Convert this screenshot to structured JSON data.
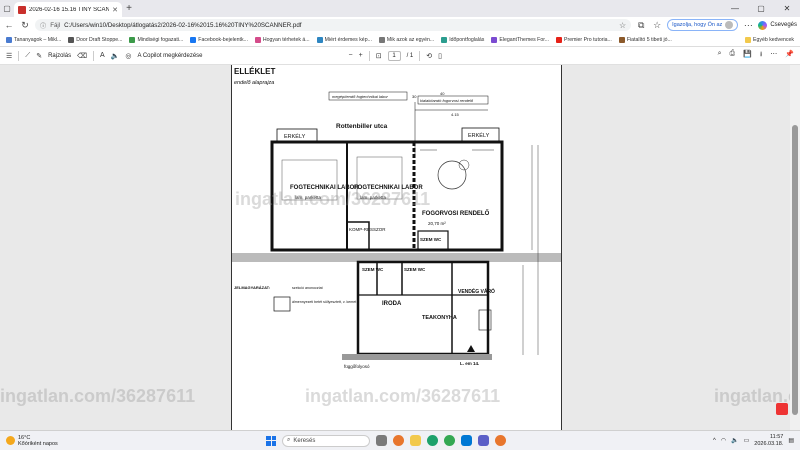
{
  "tab": {
    "title": "2026-02-16 15.16 TINY SCANNER"
  },
  "address": {
    "label": "Fájl",
    "url": "C:/Users/win10/Desktop/átlogatás2/2026-02-16%2015.16%20TINY%20SCANNER.pdf"
  },
  "signin": {
    "label": "Igazolja, hogy Ön az"
  },
  "copilot": {
    "label": "Csevegés"
  },
  "bookmarks": [
    {
      "label": "Tananyagok – Mikl...",
      "color": "#4a7bd0"
    },
    {
      "label": "Door Draft Stoppe...",
      "color": "#555555"
    },
    {
      "label": "Mindiségi fogazati...",
      "color": "#3c9a4a"
    },
    {
      "label": "Facebook-bejelentk...",
      "color": "#1877f2"
    },
    {
      "label": "Hogyan térhetek á...",
      "color": "#d44c8a"
    },
    {
      "label": "Miért érdemes kép...",
      "color": "#2e86c1"
    },
    {
      "label": "Mik azok az egyén...",
      "color": "#777777"
    },
    {
      "label": "Időpontfoglalás",
      "color": "#2b9d8f"
    },
    {
      "label": "ElegantThemes For...",
      "color": "#7b4bd1"
    },
    {
      "label": "Premier Pro tutoria...",
      "color": "#e62117"
    },
    {
      "label": "Fiatalító 5 tibeti jó...",
      "color": "#8c5a2b"
    }
  ],
  "bookmarks_other": "Egyéb kedvencek",
  "pdf_toolbar": {
    "draw": "Rajzolás",
    "copilot": "A Copilot megkérdezése",
    "zoom_minus": "−",
    "zoom_plus": "+",
    "page_current": "1",
    "page_total": "/ 1"
  },
  "plan": {
    "header": "ELLÉKLET",
    "subheader": "endelő alaprajza",
    "top_label_1": "megépítendő fogtechnikai labor",
    "top_label_2": "kialakítandó fogorvosi rendelő",
    "street": "Rottenbiller utca",
    "erkely_left": "ERKÉLY",
    "erkely_right": "ERKÉLY",
    "room1_title": "FOGTECHNIKAI LABOR",
    "room1_detail": "lam. parketta",
    "room2_title": "FOGTECHNIKAI LABOR",
    "room2_detail": "lam. parketta",
    "room3_title": "FOGORVOSI RENDELŐ",
    "room3_detail": "20,70 m²",
    "kompresszor": "KOMP-RESSZOR",
    "szem_wc_1": "SZEM WC",
    "szem_wc_2": "SZEM WC",
    "szem_wc_3": "SZEM WC",
    "iroda": "IRODA",
    "teakonyha": "TEAKONYHA",
    "vendeg_varo": "VENDÉG VÁRÓ",
    "jelmagyarazat": "JELMAGYARÁZAT:",
    "legend_1": "szekció anonocztat",
    "legend_2": "álmennyezeti betét süllyesztett, v. kemet",
    "fuggofolyoso": "függőfolyosó",
    "lepcso": "L. em 14.",
    "dim_1": "4.15",
    "dim_2": "30",
    "dim_3": "40"
  },
  "watermark": "ingatlan.com/36287611",
  "taskbar": {
    "temp": "16°C",
    "weather": "Kőóriként napos",
    "search": "Keresés",
    "time": "11:57",
    "date": "2026.03.18."
  }
}
